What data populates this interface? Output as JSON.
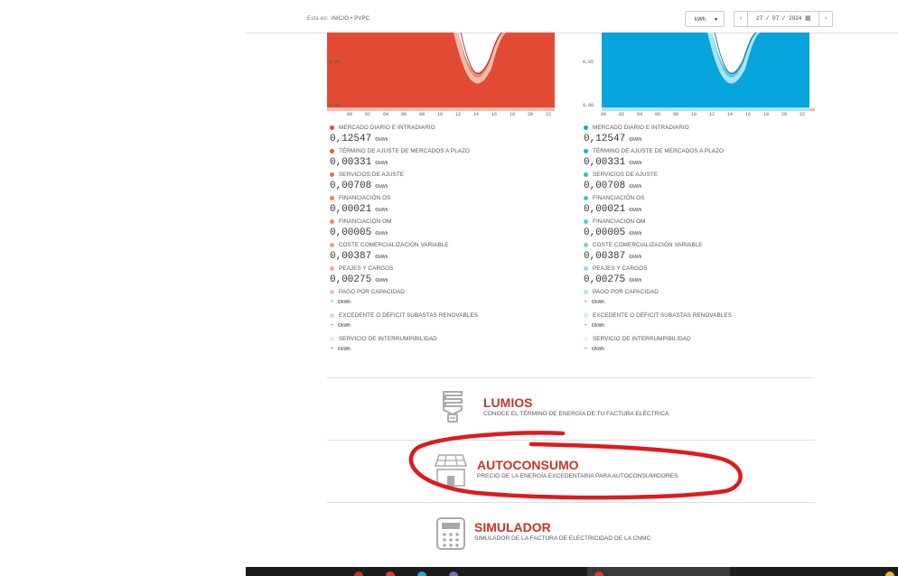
{
  "breadcrumb": {
    "label": "Está en:",
    "path": "INICIO • PVPC"
  },
  "controls": {
    "unit": "kWh",
    "date": "27 / 07 / 2024"
  },
  "chart_axis": {
    "y_ticks": [
      "0,05",
      "0,00"
    ],
    "x_ticks": [
      "00",
      "02",
      "04",
      "06",
      "08",
      "10",
      "12",
      "14",
      "16",
      "18",
      "20",
      "22"
    ]
  },
  "colors": {
    "left_accent": "#e34a33",
    "right_accent": "#06a4dd",
    "brand_red": "#c6352b",
    "annotation": "#e0191f"
  },
  "panels": [
    {
      "side": "left",
      "components": [
        {
          "label": "MERCADO DIARIO E INTRADIARIO",
          "value": "0,12547",
          "unit": "€/kWh",
          "color": "#e34a33"
        },
        {
          "label": "TÉRMINO DE AJUSTE DE MERCADOS A PLAZO",
          "value": "0,00331",
          "unit": "€/kWh",
          "color": "#e5573d"
        },
        {
          "label": "SERVICIOS DE AJUSTE",
          "value": "0,00708",
          "unit": "€/kWh",
          "color": "#e86a4f"
        },
        {
          "label": "FINANCIACIÓN OS",
          "value": "0,00021",
          "unit": "€/kWh",
          "color": "#ea7a60"
        },
        {
          "label": "FINANCIACIÓN OM",
          "value": "0,00005",
          "unit": "€/kWh",
          "color": "#ec8a72"
        },
        {
          "label": "COSTE COMERCIALIZACIÓN VARIABLE",
          "value": "0,00387",
          "unit": "€/kWh",
          "color": "#ef9a85"
        },
        {
          "label": "PEAJES Y CARGOS",
          "value": "0,00275",
          "unit": "€/kWh",
          "color": "#f2ab98"
        },
        {
          "label": "PAGO POR CAPACIDAD",
          "value": "-",
          "unit": "€/kWh",
          "color": "#f5bcad"
        },
        {
          "label": "EXCEDENTE O DÉFICIT SUBASTAS RENOVABLES",
          "value": "-",
          "unit": "€/kWh",
          "color": "#f8cfc4"
        },
        {
          "label": "SERVICIO DE INTERRUMPIBILIDAD",
          "value": "-",
          "unit": "€/kWh",
          "color": "#fbe2db"
        }
      ]
    },
    {
      "side": "right",
      "components": [
        {
          "label": "MERCADO DIARIO E INTRADIARIO",
          "value": "0,12547",
          "unit": "€/kWh",
          "color": "#06a4dd"
        },
        {
          "label": "TÉRMINO DE AJUSTE DE MERCADOS A PLAZO",
          "value": "0,00331",
          "unit": "€/kWh",
          "color": "#1aaee0"
        },
        {
          "label": "SERVICIOS DE AJUSTE",
          "value": "0,00708",
          "unit": "€/kWh",
          "color": "#2fb6e3"
        },
        {
          "label": "FINANCIACIÓN OS",
          "value": "0,00021",
          "unit": "€/kWh",
          "color": "#45bfe7"
        },
        {
          "label": "FINANCIACIÓN OM",
          "value": "0,00005",
          "unit": "€/kWh",
          "color": "#5cc8ea"
        },
        {
          "label": "COSTE COMERCIALIZACIÓN VARIABLE",
          "value": "0,00387",
          "unit": "€/kWh",
          "color": "#75d1ee"
        },
        {
          "label": "PEAJES Y CARGOS",
          "value": "0,00275",
          "unit": "€/kWh",
          "color": "#8fdbf2"
        },
        {
          "label": "PAGO POR CAPACIDAD",
          "value": "-",
          "unit": "€/kWh",
          "color": "#abe5f5"
        },
        {
          "label": "EXCEDENTE O DÉFICIT SUBASTAS RENOVABLES",
          "value": "-",
          "unit": "€/kWh",
          "color": "#c8eef9"
        },
        {
          "label": "SERVICIO DE INTERRUMPIBILIDAD",
          "value": "-",
          "unit": "€/kWh",
          "color": "#e3f6fc"
        }
      ]
    }
  ],
  "links": {
    "lumios": {
      "title": "LUMIOS",
      "subtitle": "CONOCE EL TÉRMINO DE ENERGÍA DE TU FACTURA ELÉCTRICA",
      "icon": "lightbulb-icon"
    },
    "autoconsumo": {
      "title": "AUTOCONSUMO",
      "subtitle": "PRECIO DE LA ENERGÍA EXCEDENTARIA PARA AUTOCONSUMIDORES",
      "icon": "solar-house-icon"
    },
    "simulador": {
      "title": "SIMULADOR",
      "subtitle": "SIMULADOR DE LA FACTURA DE ELECTRICIDAD DE LA CNMC",
      "icon": "calculator-icon"
    }
  }
}
